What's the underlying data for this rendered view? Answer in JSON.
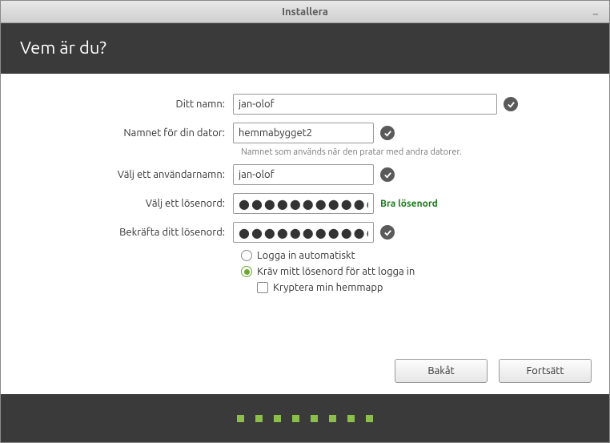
{
  "window": {
    "title": "Installera"
  },
  "header": {
    "title": "Vem är du?"
  },
  "form": {
    "name": {
      "label": "Ditt namn:",
      "value": "jan-olof"
    },
    "hostname": {
      "label": "Namnet för din dator:",
      "value": "hemmabygget2",
      "hint": "Namnet som används när den pratar med andra datorer."
    },
    "username": {
      "label": "Välj ett användarnamn:",
      "value": "jan-olof"
    },
    "password": {
      "label": "Välj ett lösenord:",
      "value": "●●●●●●●●●●●●●●",
      "strength": "Bra lösenord"
    },
    "confirm": {
      "label": "Bekräfta ditt lösenord:",
      "value": "●●●●●●●●●●●●●●"
    }
  },
  "options": {
    "auto_login": "Logga in automatiskt",
    "require_pwd": "Kräv mitt lösenord för att logga in",
    "encrypt_home": "Kryptera min hemmapp"
  },
  "buttons": {
    "back": "Bakåt",
    "next": "Fortsätt"
  },
  "colors": {
    "accent": "#6aab2d"
  }
}
